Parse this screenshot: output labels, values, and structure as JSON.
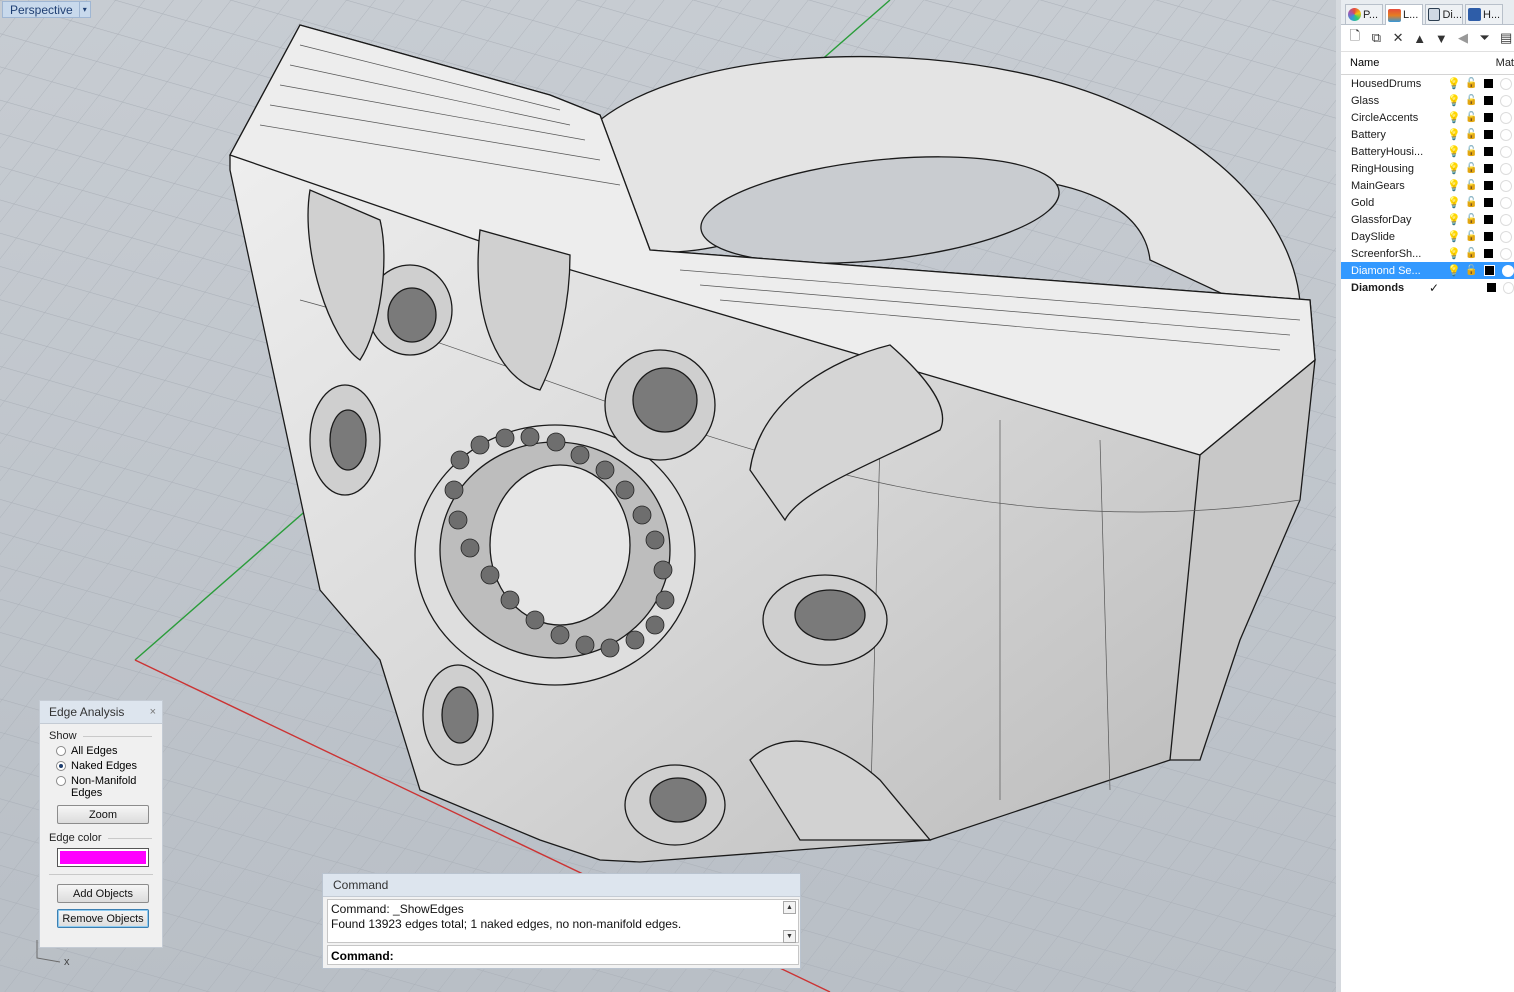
{
  "viewport": {
    "label": "Perspective",
    "menu_arrow": "▾"
  },
  "layers_panel": {
    "tabs": [
      {
        "label": "P...",
        "icon": "properties-icon",
        "color": "#c0392b"
      },
      {
        "label": "L...",
        "icon": "layers-icon",
        "color": "#e67e22"
      },
      {
        "label": "Di...",
        "icon": "display-icon",
        "color": "#2c3e50"
      },
      {
        "label": "H...",
        "icon": "help-icon",
        "color": "#2e5da8"
      }
    ],
    "columns": {
      "name": "Name",
      "material": "Mat"
    },
    "layers": [
      {
        "name": "HousedDrums"
      },
      {
        "name": "Glass"
      },
      {
        "name": "CircleAccents"
      },
      {
        "name": "Battery"
      },
      {
        "name": "BatteryHousi..."
      },
      {
        "name": "RingHousing"
      },
      {
        "name": "MainGears"
      },
      {
        "name": "Gold"
      },
      {
        "name": "GlassforDay"
      },
      {
        "name": "DaySlide"
      },
      {
        "name": "ScreenforSh..."
      },
      {
        "name": "Diamond Se..."
      }
    ],
    "current_layer": {
      "name": "Diamonds",
      "check": "✓"
    }
  },
  "edge_analysis": {
    "title": "Edge Analysis",
    "close": "×",
    "show_label": "Show",
    "options": [
      {
        "label": "All Edges",
        "selected": false
      },
      {
        "label": "Naked Edges",
        "selected": true
      },
      {
        "label": "Non-Manifold Edges",
        "selected": false
      }
    ],
    "zoom_button": "Zoom",
    "edge_color_label": "Edge color",
    "edge_color": "#ff00ff",
    "add_objects_button": "Add Objects",
    "remove_objects_button": "Remove Objects"
  },
  "command": {
    "title": "Command",
    "history": [
      "Command: _ShowEdges",
      "Found 13923 edges total; 1 naked edges, no non-manifold edges."
    ],
    "prompt": "Command:"
  },
  "axis": {
    "x_label": "x"
  }
}
